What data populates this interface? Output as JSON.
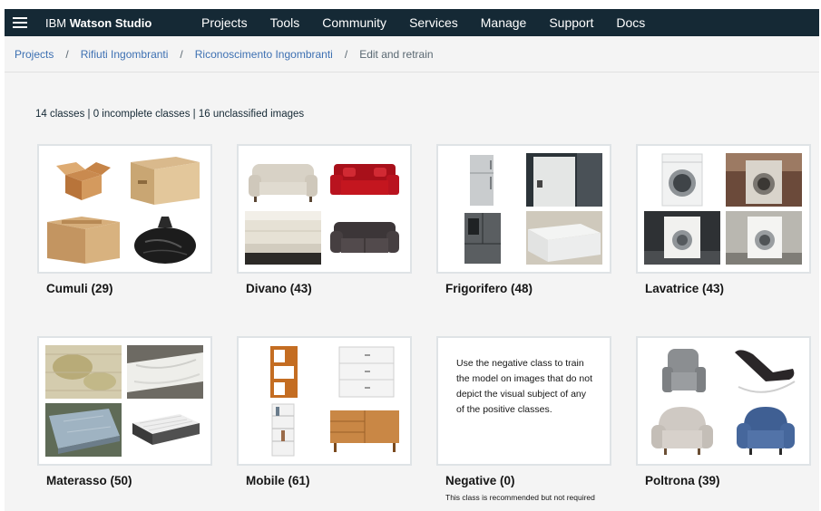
{
  "nav": {
    "brand_prefix": "IBM",
    "brand_name": "Watson Studio",
    "items": [
      "Projects",
      "Tools",
      "Community",
      "Services",
      "Manage",
      "Support",
      "Docs"
    ]
  },
  "breadcrumb": {
    "items": [
      "Projects",
      "Rifiuti Ingombranti",
      "Riconoscimento Ingombranti"
    ],
    "current": "Edit and retrain",
    "separator": "/"
  },
  "summary": "14 classes | 0 incomplete classes | 16 unclassified images",
  "classes": [
    {
      "label": "Cumuli (29)",
      "thumbs": [
        "open-cardboard-box",
        "closed-cardboard-box",
        "taped-cardboard-box",
        "black-trash-bag"
      ]
    },
    {
      "label": "Divano (43)",
      "thumbs": [
        "beige-loveseat",
        "red-sofa",
        "rolled-mattress",
        "dark-gray-sofa"
      ]
    },
    {
      "label": "Frigorifero (48)",
      "thumbs": [
        "steel-refrigerator",
        "white-fridge-photo",
        "french-door-fridge",
        "white-chest-freezer"
      ]
    },
    {
      "label": "Lavatrice (43)",
      "thumbs": [
        "washing-machine",
        "old-washing-machine",
        "washer-on-street",
        "washer-at-wall"
      ]
    },
    {
      "label": "Materasso (50)",
      "thumbs": [
        "stained-mattress",
        "wrapped-mattress",
        "mattress-on-ground",
        "spring-mattress"
      ]
    },
    {
      "label": "Mobile (61)",
      "thumbs": [
        "wooden-bookshelf",
        "white-dresser",
        "white-bookcase",
        "wooden-sideboard"
      ]
    },
    {
      "label": "Negative (0)",
      "negative": true,
      "description": "Use the negative class to train the model on images that do not depict the visual subject of any of the positive classes.",
      "note": "This class is recommended but not required"
    },
    {
      "label": "Poltrona (39)",
      "thumbs": [
        "gray-recliner",
        "black-rocking-chair",
        "beige-armchair",
        "blue-armchair"
      ]
    }
  ],
  "colors": {
    "nav_bg": "#152935",
    "link": "#3d70b2",
    "page_bg": "#f4f4f4",
    "tile_border": "#dfe3e6"
  }
}
